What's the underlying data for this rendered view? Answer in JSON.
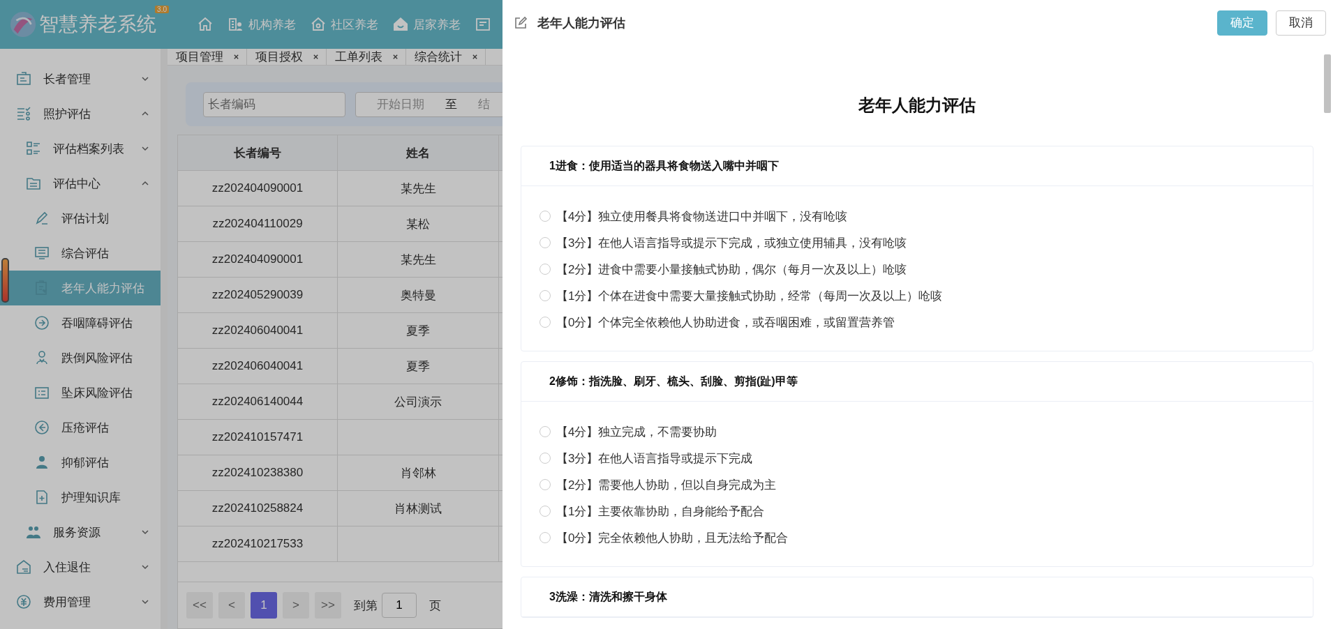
{
  "app": {
    "logo_text": "智慧养老系统",
    "version": "3.0"
  },
  "top_nav": [
    {
      "label": "机构养老"
    },
    {
      "label": "社区养老"
    },
    {
      "label": "居家养老"
    }
  ],
  "sidebar": {
    "items": [
      {
        "label": "长者管理",
        "expanded": false
      },
      {
        "label": "照护评估",
        "expanded": true,
        "children": [
          {
            "label": "评估档案列表",
            "expanded": false
          },
          {
            "label": "评估中心",
            "expanded": true,
            "children": [
              {
                "label": "评估计划",
                "selected": false
              },
              {
                "label": "综合评估",
                "selected": false
              },
              {
                "label": "老年人能力评估",
                "selected": true
              },
              {
                "label": "吞咽障碍评估",
                "selected": false
              },
              {
                "label": "跌倒风险评估",
                "selected": false
              },
              {
                "label": "坠床风险评估",
                "selected": false
              },
              {
                "label": "压疮评估",
                "selected": false
              },
              {
                "label": "抑郁评估",
                "selected": false
              },
              {
                "label": "护理知识库",
                "selected": false
              }
            ]
          },
          {
            "label": "服务资源",
            "expanded": false
          }
        ]
      },
      {
        "label": "入住退住",
        "expanded": false
      },
      {
        "label": "费用管理",
        "expanded": false
      }
    ]
  },
  "tabs": [
    {
      "label": "项目管理"
    },
    {
      "label": "项目授权"
    },
    {
      "label": "工单列表"
    },
    {
      "label": "综合统计"
    }
  ],
  "filters": {
    "code_placeholder": "长者编码",
    "start_placeholder": "开始日期",
    "separator": "至",
    "end_placeholder": "结"
  },
  "table": {
    "columns": [
      "长者编号",
      "姓名"
    ],
    "rows": [
      {
        "code": "zz202404090001",
        "name": "某先生"
      },
      {
        "code": "zz202404110029",
        "name": "某松"
      },
      {
        "code": "zz202404090001",
        "name": "某先生"
      },
      {
        "code": "zz202405290039",
        "name": "奥特曼"
      },
      {
        "code": "zz202406040041",
        "name": "夏季"
      },
      {
        "code": "zz202406040041",
        "name": "夏季"
      },
      {
        "code": "zz202406140044",
        "name": "公司演示"
      },
      {
        "code": "zz202410157471"
      },
      {
        "code": "zz202410238380",
        "name": "肖邻林"
      },
      {
        "code": "zz202410258824",
        "name": "肖林测试"
      },
      {
        "code": "zz202410217533"
      }
    ]
  },
  "pagination": {
    "first": "<<",
    "prev": "<",
    "pages": [
      {
        "label": "1",
        "selected": true
      }
    ],
    "next": ">",
    "last": ">>",
    "goto_label": "到第",
    "goto_value": "1",
    "suffix": "页"
  },
  "drawer": {
    "title": "老年人能力评估",
    "confirm": "确定",
    "cancel": "取消",
    "form_title": "老年人能力评估",
    "sections": [
      {
        "title": "1进食：使用适当的器具将食物送入嘴中并咽下",
        "options": [
          {
            "label": "【4分】独立使用餐具将食物送进口中并咽下，没有呛咳",
            "selected": false
          },
          {
            "label": "【3分】在他人语言指导或提示下完成，或独立使用辅具，没有呛咳",
            "selected": false
          },
          {
            "label": "【2分】进食中需要小量接触式协助，偶尔（每月一次及以上）呛咳",
            "selected": false
          },
          {
            "label": "【1分】个体在进食中需要大量接触式协助，经常（每周一次及以上）呛咳",
            "selected": false
          },
          {
            "label": "【0分】个体完全依赖他人协助进食，或吞咽困难，或留置营养管",
            "selected": false
          }
        ]
      },
      {
        "title": "2修饰：指洗脸、刷牙、梳头、刮脸、剪指(趾)甲等",
        "options": [
          {
            "label": "【4分】独立完成，不需要协助",
            "selected": false
          },
          {
            "label": "【3分】在他人语言指导或提示下完成",
            "selected": false
          },
          {
            "label": "【2分】需要他人协助，但以自身完成为主",
            "selected": false
          },
          {
            "label": "【1分】主要依靠协助，自身能给予配合",
            "selected": false
          },
          {
            "label": "【0分】完全依赖他人协助，且无法给予配合",
            "selected": false
          }
        ]
      },
      {
        "title": "3洗澡：清洗和擦干身体"
      }
    ]
  }
}
